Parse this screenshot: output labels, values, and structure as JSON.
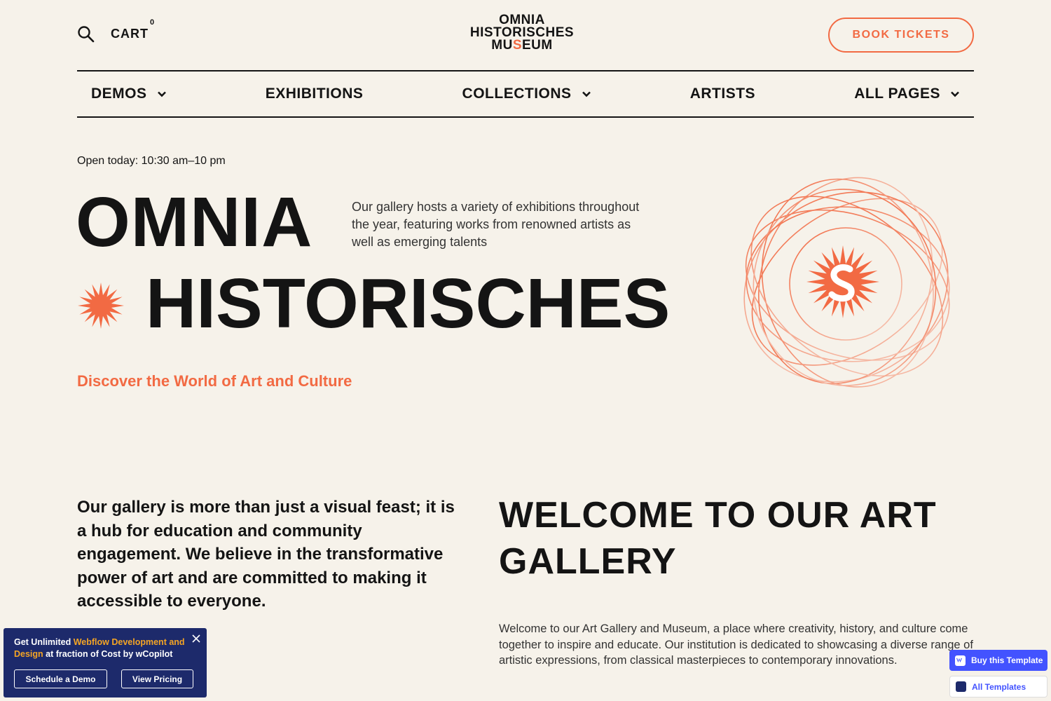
{
  "header": {
    "cart_label": "CART",
    "cart_count": "0",
    "logo_line1": "OMNIA",
    "logo_line2": "HISTORISCHES",
    "logo_line3_a": "MU",
    "logo_line3_s": "S",
    "logo_line3_b": "EUM",
    "book_label": "BOOK TICKETS",
    "search_icon": "search-icon"
  },
  "nav": {
    "items": [
      {
        "label": "DEMOS",
        "has_dropdown": true
      },
      {
        "label": "EXHIBITIONS",
        "has_dropdown": false
      },
      {
        "label": "COLLECTIONS",
        "has_dropdown": true
      },
      {
        "label": "ARTISTS",
        "has_dropdown": false
      },
      {
        "label": "ALL PAGES",
        "has_dropdown": true
      }
    ]
  },
  "hero": {
    "open_today": "Open today: 10:30 am–10 pm",
    "title_line1": "OMNIA",
    "title_line2": "HISTORISCHES",
    "intro": "Our gallery hosts a variety of exhibitions throughout the year, featuring works from renowned artists as well as emerging talents",
    "discover": "Discover the World of Art and Culture"
  },
  "about": {
    "mission": "Our gallery is more than just a visual feast; it is a hub for education and community engagement. We believe in the transformative power of art and are committed to making it accessible to everyone.",
    "welcome_title": "WELCOME TO OUR ART GALLERY",
    "welcome_text": "Welcome to our Art Gallery and Museum, a place where creativity, history, and culture come together to inspire and educate. Our institution is dedicated to showcasing a diverse range of artistic expressions, from classical masterpieces to contemporary innovations."
  },
  "promo": {
    "text_a": "Get Unlimited ",
    "text_highlight": "Webflow Development and Design",
    "text_b": " at fraction of Cost by wCopilot",
    "schedule_label": "Schedule a Demo",
    "pricing_label": "View Pricing"
  },
  "badges": {
    "buy_label": "Buy this Template",
    "all_label": "All Templates"
  },
  "colors": {
    "accent": "#f26a43",
    "background": "#f6f2ea",
    "text": "#141414",
    "promo_bg": "#1d2a6b",
    "webflow_blue": "#4353ff"
  }
}
